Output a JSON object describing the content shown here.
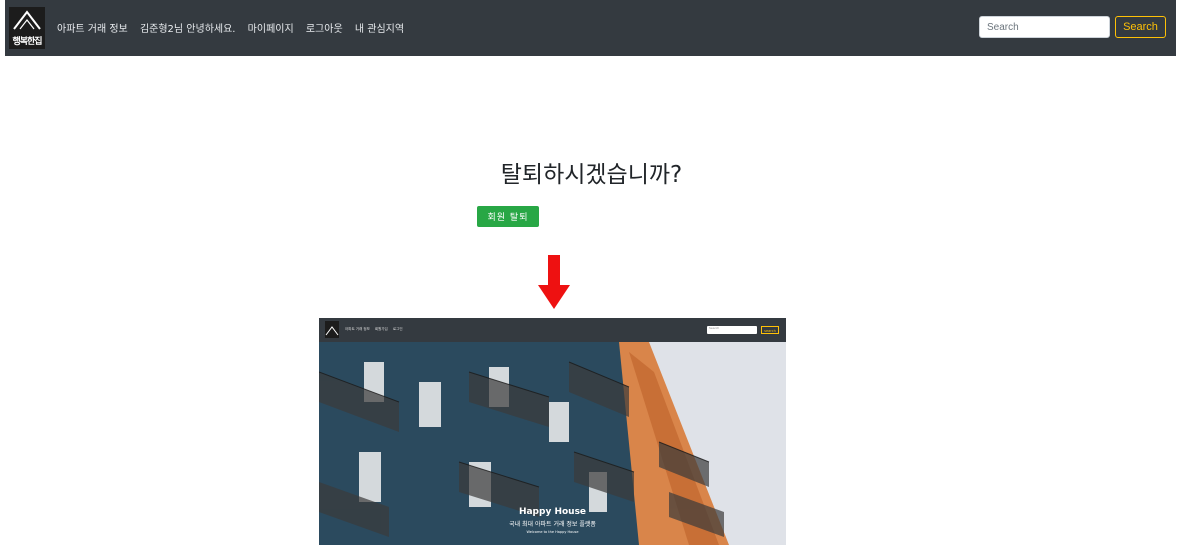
{
  "navbar": {
    "logo_text": "행복한집",
    "links": [
      "아파트 거래 정보",
      "김준형2님 안녕하세요.",
      "마이페이지",
      "로그아웃",
      "내 관심지역"
    ],
    "search_placeholder": "Search",
    "search_button": "Search"
  },
  "main": {
    "question": "탈퇴하시겠습니까?",
    "withdraw_button": "회원 탈퇴"
  },
  "preview": {
    "nav_links": [
      "아파트 거래 정보",
      "회원가입",
      "로그인"
    ],
    "search_placeholder": "Search",
    "search_button": "search",
    "title": "Happy House",
    "subtitle": "국내 최대 아파트 거래 정보 플랫폼",
    "welcome": "Welcome to the Happy House"
  },
  "colors": {
    "navbar_bg": "#343a40",
    "search_accent": "#ffc107",
    "withdraw_button": "#28a745",
    "arrow": "#ee1111"
  }
}
